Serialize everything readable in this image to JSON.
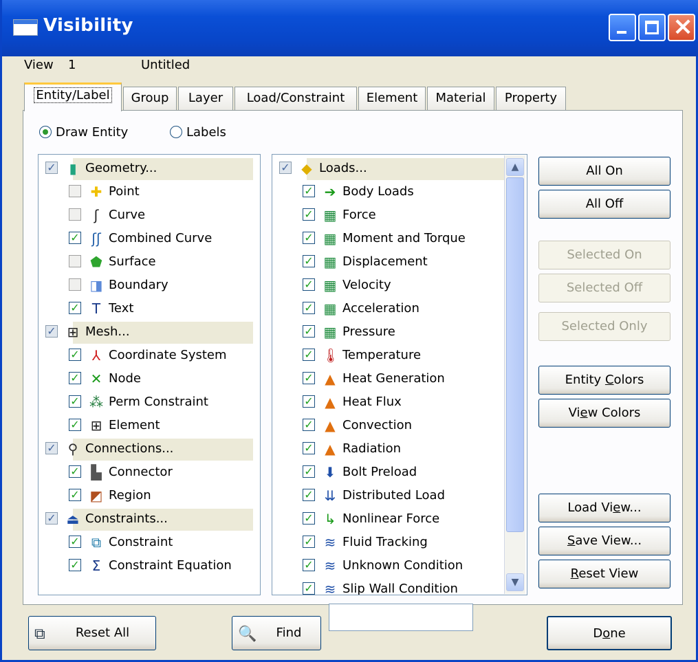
{
  "window": {
    "title": "Visibility"
  },
  "view_info": {
    "label": "View",
    "number": "1",
    "name": "Untitled"
  },
  "tabs": [
    "Entity/Label",
    "Group",
    "Layer",
    "Load/Constraint",
    "Element",
    "Material",
    "Property"
  ],
  "mode": {
    "draw_entity": "Draw Entity",
    "labels": "Labels",
    "selected": "Draw Entity"
  },
  "entity_list": [
    {
      "label": "Geometry...",
      "header": true,
      "checked": "partial",
      "icon": "geometry-cylinder-icon"
    },
    {
      "label": "Point",
      "checked": false,
      "icon": "point-icon"
    },
    {
      "label": "Curve",
      "checked": false,
      "icon": "curve-icon"
    },
    {
      "label": "Combined Curve",
      "checked": true,
      "icon": "combined-curve-icon"
    },
    {
      "label": "Surface",
      "checked": false,
      "icon": "surface-icon"
    },
    {
      "label": "Boundary",
      "checked": false,
      "icon": "boundary-icon"
    },
    {
      "label": "Text",
      "checked": true,
      "icon": "text-icon"
    },
    {
      "label": "Mesh...",
      "header": true,
      "checked": "partial",
      "icon": "mesh-grid-icon"
    },
    {
      "label": "Coordinate System",
      "checked": true,
      "icon": "coordinate-system-icon"
    },
    {
      "label": "Node",
      "checked": true,
      "icon": "node-icon"
    },
    {
      "label": "Perm Constraint",
      "checked": true,
      "icon": "perm-constraint-icon"
    },
    {
      "label": "Element",
      "checked": true,
      "icon": "element-grid-icon"
    },
    {
      "label": "Connections...",
      "header": true,
      "checked": "partial",
      "icon": "connections-icon"
    },
    {
      "label": "Connector",
      "checked": true,
      "icon": "connector-icon"
    },
    {
      "label": "Region",
      "checked": true,
      "icon": "region-icon"
    },
    {
      "label": "Constraints...",
      "header": true,
      "checked": "partial",
      "icon": "constraints-icon"
    },
    {
      "label": "Constraint",
      "checked": true,
      "icon": "constraint-icon"
    },
    {
      "label": "Constraint Equation",
      "checked": true,
      "icon": "constraint-equation-icon"
    }
  ],
  "loads_list": [
    {
      "label": "Loads...",
      "header": true,
      "checked": "partial",
      "icon": "loads-icon"
    },
    {
      "label": "Body Loads",
      "checked": true,
      "icon": "body-loads-icon"
    },
    {
      "label": "Force",
      "checked": true,
      "icon": "force-icon"
    },
    {
      "label": "Moment and Torque",
      "checked": true,
      "icon": "moment-icon"
    },
    {
      "label": "Displacement",
      "checked": true,
      "icon": "displacement-icon"
    },
    {
      "label": "Velocity",
      "checked": true,
      "icon": "velocity-icon"
    },
    {
      "label": "Acceleration",
      "checked": true,
      "icon": "acceleration-icon"
    },
    {
      "label": "Pressure",
      "checked": true,
      "icon": "pressure-icon"
    },
    {
      "label": "Temperature",
      "checked": true,
      "icon": "thermometer-icon"
    },
    {
      "label": "Heat Generation",
      "checked": true,
      "icon": "flame-icon"
    },
    {
      "label": "Heat Flux",
      "checked": true,
      "icon": "flame-icon"
    },
    {
      "label": "Convection",
      "checked": true,
      "icon": "flame-icon"
    },
    {
      "label": "Radiation",
      "checked": true,
      "icon": "flame-icon"
    },
    {
      "label": "Bolt Preload",
      "checked": true,
      "icon": "bolt-icon"
    },
    {
      "label": "Distributed Load",
      "checked": true,
      "icon": "distributed-load-icon"
    },
    {
      "label": "Nonlinear Force",
      "checked": true,
      "icon": "nonlinear-force-icon"
    },
    {
      "label": "Fluid Tracking",
      "checked": true,
      "icon": "fluid-wave-icon"
    },
    {
      "label": "Unknown Condition",
      "checked": true,
      "icon": "fluid-wave-icon"
    },
    {
      "label": "Slip Wall Condition",
      "checked": true,
      "icon": "fluid-wave-icon"
    }
  ],
  "side_buttons": {
    "all_on": "All On",
    "all_off": "All Off",
    "selected_on": "Selected On",
    "selected_off": "Selected Off",
    "selected_only": "Selected Only",
    "entity_colors_pre": "Entity ",
    "entity_colors_u": "C",
    "entity_colors_post": "olors",
    "view_colors_pre": "Vi",
    "view_colors_u": "e",
    "view_colors_post": "w Colors",
    "load_view_pre": "Load Vi",
    "load_view_u": "e",
    "load_view_post": "w...",
    "save_view_pre": "",
    "save_view_u": "S",
    "save_view_post": "ave View...",
    "reset_view_pre": "",
    "reset_view_u": "R",
    "reset_view_post": "eset View"
  },
  "bottom": {
    "reset_all": "Reset All",
    "find": "Find",
    "find_value": "",
    "done_pre": "D",
    "done_u": "o",
    "done_post": "ne"
  },
  "colors": {
    "title_bar": "#0a4fd6",
    "check": "#21a121",
    "dialog_bg": "#ece9d8"
  }
}
